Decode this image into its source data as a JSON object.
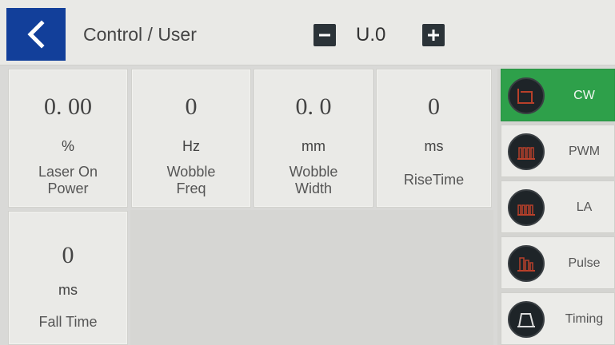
{
  "header": {
    "title": "Control / User",
    "unit_value": "U.0"
  },
  "params": {
    "power": {
      "value": "0. 00",
      "unit": "%",
      "label": "Laser On\nPower"
    },
    "wobble_freq": {
      "value": "0",
      "unit": "Hz",
      "label": "Wobble\nFreq"
    },
    "wobble_width": {
      "value": "0. 0",
      "unit": "mm",
      "label": "Wobble\nWidth"
    },
    "rise_time": {
      "value": "0",
      "unit": "ms",
      "label": "RiseTime"
    },
    "fall_time": {
      "value": "0",
      "unit": "ms",
      "label": "Fall Time"
    }
  },
  "modes": {
    "active": "CW",
    "items": [
      {
        "label": "CW",
        "icon": "cw-waveform-icon"
      },
      {
        "label": "PWM",
        "icon": "pwm-waveform-icon"
      },
      {
        "label": "LA",
        "icon": "la-waveform-icon"
      },
      {
        "label": "Pulse",
        "icon": "pulse-waveform-icon"
      },
      {
        "label": "Timing",
        "icon": "timing-waveform-icon"
      }
    ]
  },
  "colors": {
    "back_button": "#123f9a",
    "active_mode": "#2ea04a",
    "waveform": "#b8402a"
  }
}
